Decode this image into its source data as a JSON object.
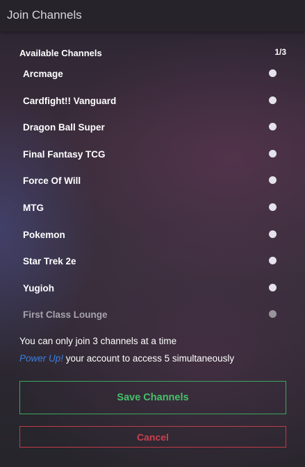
{
  "header": {
    "title": "Join Channels"
  },
  "channels_section": {
    "title": "Available Channels",
    "counter": "1/3",
    "items": [
      {
        "label": "Arcmage",
        "enabled": true
      },
      {
        "label": "Cardfight!! Vanguard",
        "enabled": true
      },
      {
        "label": "Dragon Ball Super",
        "enabled": true
      },
      {
        "label": "Final Fantasy TCG",
        "enabled": true
      },
      {
        "label": "Force Of Will",
        "enabled": true
      },
      {
        "label": "MTG",
        "enabled": true
      },
      {
        "label": "Pokemon",
        "enabled": true
      },
      {
        "label": "Star Trek 2e",
        "enabled": true
      },
      {
        "label": "Yugioh",
        "enabled": true
      },
      {
        "label": "First Class Lounge",
        "enabled": false
      }
    ]
  },
  "notes": {
    "limit": "You can only join 3 channels at a time",
    "powerup_link": "Power Up!",
    "powerup_rest": " your account to access 5 simultaneously"
  },
  "buttons": {
    "save_label": "Save Channels",
    "cancel_label": "Cancel"
  },
  "colors": {
    "save_accent": "#46c06a",
    "cancel_accent": "#c8414f",
    "link": "#3b7fe0",
    "toggle_on": "#e4e2ea",
    "toggle_disabled": "#97949b"
  },
  "icons": {
    "channel_toggle": "radio-dot-icon"
  }
}
